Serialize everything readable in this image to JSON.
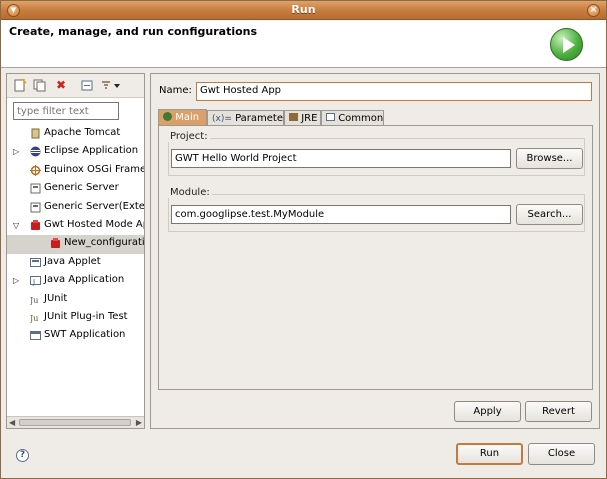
{
  "window": {
    "title": "Run"
  },
  "header": {
    "title": "Create, manage, and run configurations"
  },
  "left": {
    "filter_placeholder": "type filter text",
    "tree": [
      {
        "label": "Apache Tomcat",
        "icon": "tomcat-icon",
        "expander": "",
        "indent": 0
      },
      {
        "label": "Eclipse Application",
        "icon": "eclipse-icon",
        "expander": "▷",
        "indent": 0
      },
      {
        "label": "Equinox OSGi Framework",
        "icon": "osgi-icon",
        "expander": "",
        "indent": 0
      },
      {
        "label": "Generic Server",
        "icon": "server-icon",
        "expander": "",
        "indent": 0
      },
      {
        "label": "Generic Server(External)",
        "icon": "server-icon",
        "expander": "",
        "indent": 0
      },
      {
        "label": "Gwt Hosted Mode Application",
        "icon": "gwt-icon",
        "expander": "▽",
        "indent": 0
      },
      {
        "label": "New_configuration",
        "icon": "gwt-config-icon",
        "expander": "",
        "indent": 1,
        "selected": true
      },
      {
        "label": "Java Applet",
        "icon": "applet-icon",
        "expander": "",
        "indent": 0
      },
      {
        "label": "Java Application",
        "icon": "java-app-icon",
        "expander": "▷",
        "indent": 0
      },
      {
        "label": "JUnit",
        "icon": "junit-icon",
        "expander": "",
        "indent": 0
      },
      {
        "label": "JUnit Plug-in Test",
        "icon": "junit-plugin-icon",
        "expander": "",
        "indent": 0
      },
      {
        "label": "SWT Application",
        "icon": "swt-icon",
        "expander": "",
        "indent": 0
      }
    ]
  },
  "form": {
    "name_label": "Name:",
    "name_value": "Gwt Hosted App",
    "tabs": [
      "Main",
      "Parameters",
      "JRE",
      "Common"
    ],
    "project_label": "Project:",
    "project_value": "GWT Hello World Project",
    "browse_label": "Browse...",
    "module_label": "Module:",
    "module_value": "com.googlipse.test.MyModule",
    "search_label": "Search...",
    "apply_label": "Apply",
    "revert_label": "Revert"
  },
  "footer": {
    "run_label": "Run",
    "close_label": "Close"
  },
  "colors": {
    "accent": "#c27a3f",
    "titlebar": "#c57b3e"
  }
}
